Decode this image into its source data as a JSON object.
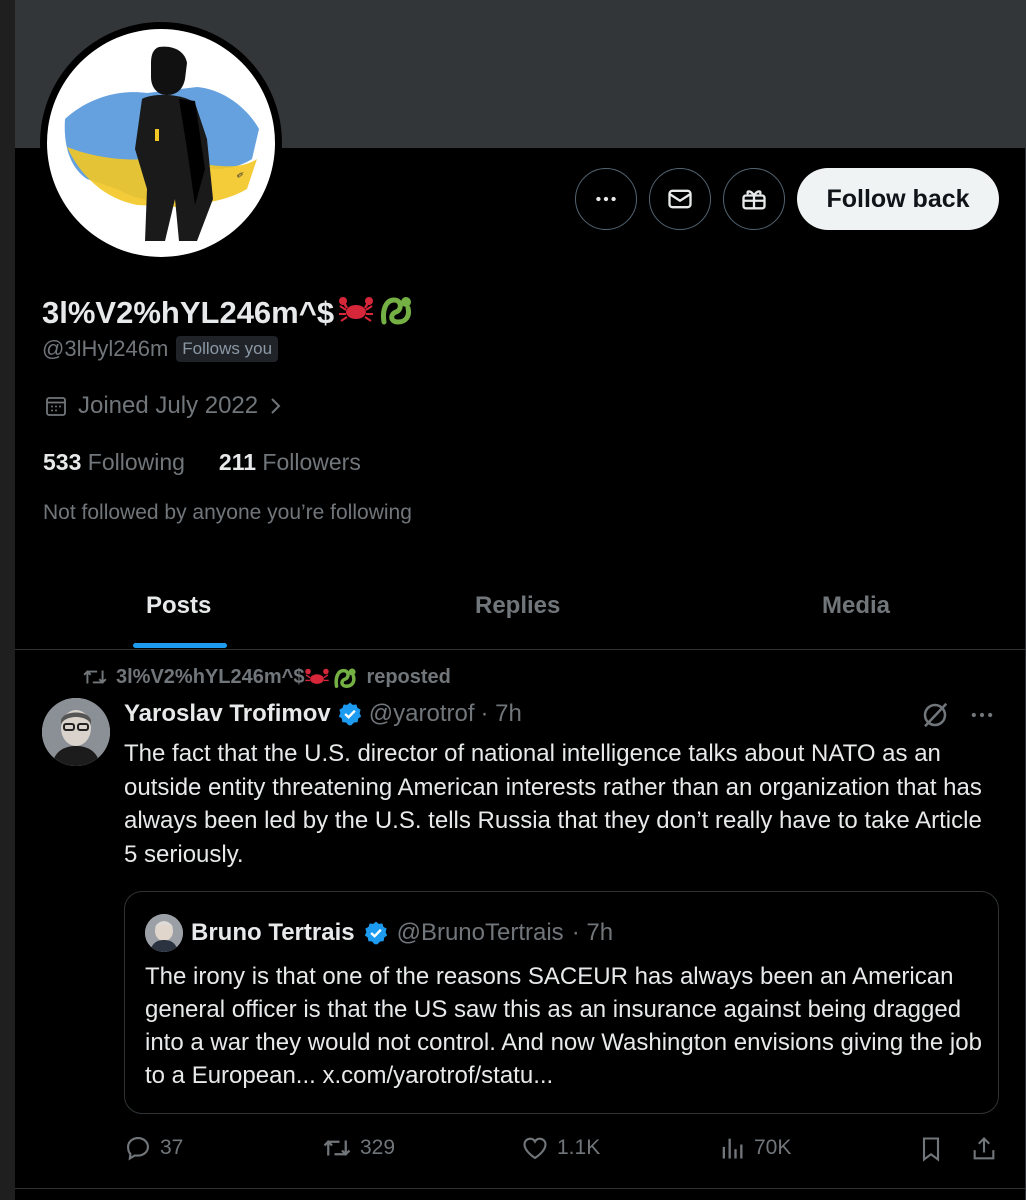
{
  "profile": {
    "display_name": "3l%V2%hYL246m^$",
    "name_emojis": [
      "🦀",
      "ᘏ"
    ],
    "handle": "@3lHyl246m",
    "follows_you": "Follows you",
    "joined": "Joined July 2022",
    "following_count": "533",
    "following_label": "Following",
    "followers_count": "211",
    "followers_label": "Followers",
    "mutuals_note": "Not followed by anyone you’re following",
    "avatar_icon": "soldier-illustration-ukraine-map"
  },
  "actions_bar": {
    "more_icon": "more-icon",
    "message_icon": "mail-icon",
    "gift_icon": "gift-icon",
    "follow_label": "Follow back"
  },
  "tabs": [
    {
      "label": "Posts",
      "active": true
    },
    {
      "label": "Replies",
      "active": false
    },
    {
      "label": "Media",
      "active": false
    }
  ],
  "post": {
    "repost_by": "3l%V2%hYL246m^$",
    "repost_suffix": "reposted",
    "author_name": "Yaroslav Trofimov",
    "author_handle": "@yarotrof",
    "time": "· 7h",
    "text": "The fact that the U.S. director of national intelligence talks about NATO as an outside entity threatening American interests rather than an organization that has always been led by the U.S. tells Russia that they don’t really have to take Article 5 seriously.",
    "quote": {
      "author_name": "Bruno Tertrais",
      "author_handle": "@BrunoTertrais",
      "time": "· 7h",
      "text": "The irony is that one of the reasons SACEUR has always been an American general officer is that the US saw this as an insurance against being dragged into a war they would not control. And now Washington envisions giving the job to a European... x.com/yarotrof/statu..."
    },
    "stats": {
      "replies": "37",
      "reposts": "329",
      "likes": "1.1K",
      "views": "70K"
    }
  },
  "colors": {
    "accent": "#1d9bf0",
    "background": "#000000",
    "muted": "#71767b",
    "text": "#e7e9ea",
    "verified": "#1d9bf0"
  }
}
